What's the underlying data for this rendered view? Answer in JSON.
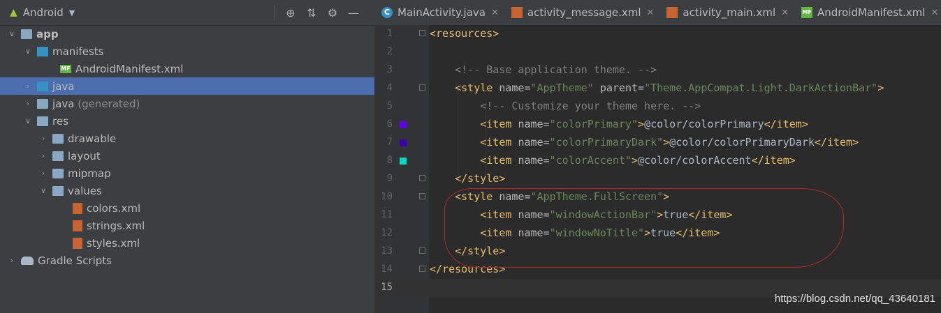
{
  "project_panel": {
    "view_label": "Android",
    "tree": [
      {
        "label": "app",
        "bold": true
      },
      {
        "label": "manifests"
      },
      {
        "label": "AndroidManifest.xml"
      },
      {
        "label": "java"
      },
      {
        "label": "java",
        "suffix": "(generated)"
      },
      {
        "label": "res"
      },
      {
        "label": "drawable"
      },
      {
        "label": "layout"
      },
      {
        "label": "mipmap"
      },
      {
        "label": "values"
      },
      {
        "label": "colors.xml"
      },
      {
        "label": "strings.xml"
      },
      {
        "label": "styles.xml"
      },
      {
        "label": "Gradle Scripts"
      }
    ]
  },
  "tabs": [
    {
      "label": "MainActivity.java",
      "icon": "java-class-icon"
    },
    {
      "label": "activity_message.xml",
      "icon": "xml-file-icon"
    },
    {
      "label": "activity_main.xml",
      "icon": "xml-file-icon"
    },
    {
      "label": "AndroidManifest.xml",
      "icon": "manifest-file-icon"
    }
  ],
  "editor": {
    "line_numbers": [
      "1",
      "2",
      "3",
      "4",
      "5",
      "6",
      "7",
      "8",
      "9",
      "10",
      "11",
      "12",
      "13",
      "14",
      "15"
    ],
    "colors": {
      "colorPrimary": "#6200ee",
      "colorPrimaryDark": "#3700b3",
      "colorAccent": "#03dac5"
    }
  },
  "watermark": "https://blog.csdn.net/qq_43640181"
}
